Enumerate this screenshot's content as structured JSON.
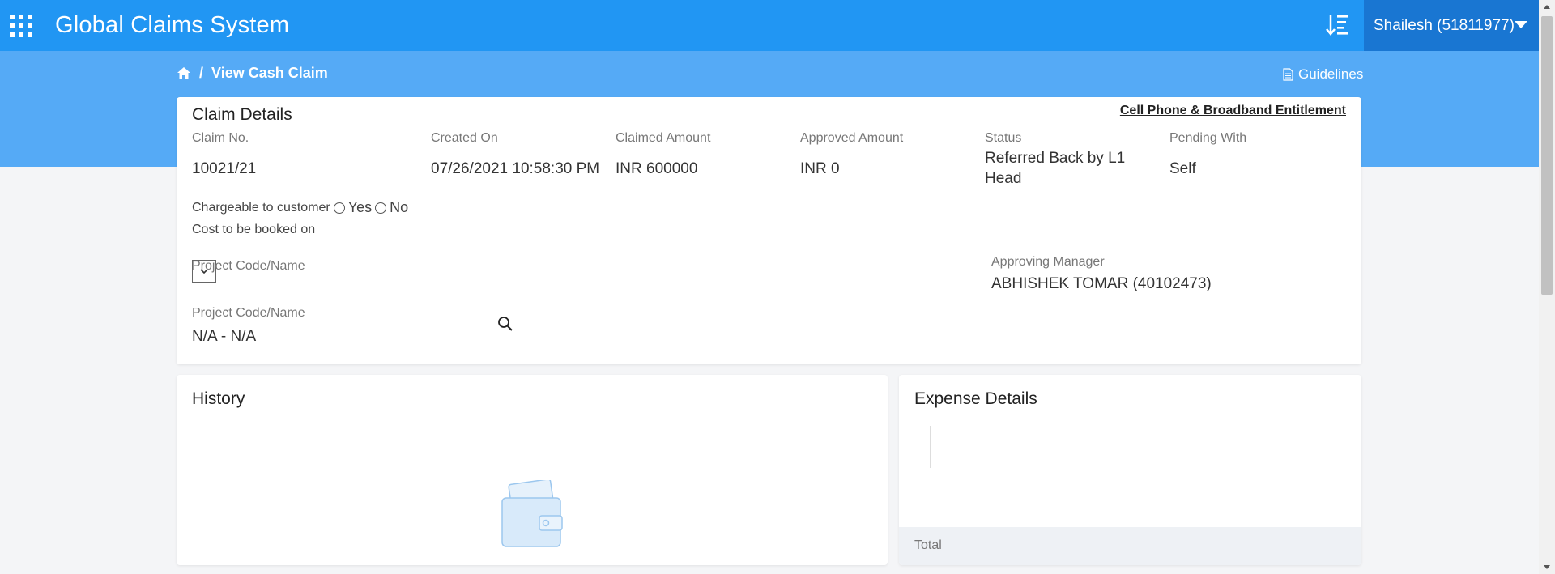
{
  "header": {
    "app_title": "Global Claims System",
    "user_label": "Shailesh (51811977)",
    "apps_icon": "apps-grid-icon",
    "sort_icon": "sort-list-icon"
  },
  "breadcrumb": {
    "home_icon": "home-icon",
    "separator": "/",
    "current": "View Cash Claim"
  },
  "guidelines": {
    "label": "Guidelines",
    "icon": "document-icon"
  },
  "claim_details": {
    "title": "Claim Details",
    "entitlement_link": "Cell Phone & Broadband Entitlement",
    "fields": {
      "claim_no": {
        "label": "Claim No.",
        "value": "10021/21"
      },
      "created_on": {
        "label": "Created On",
        "value": "07/26/2021 10:58:30 PM"
      },
      "claimed_amount": {
        "label": "Claimed Amount",
        "value": "INR 600000"
      },
      "approved_amount": {
        "label": "Approved Amount",
        "value": "INR 0"
      },
      "status": {
        "label": "Status",
        "value": "Referred Back by L1 Head"
      },
      "pending_with": {
        "label": "Pending With",
        "value": "Self"
      }
    },
    "chargeable": {
      "label": "Chargeable to customer",
      "yes": "Yes",
      "no": "No"
    },
    "cost_booked_label": "Cost to be booked on",
    "project_select_label": "Project Code/Name",
    "project": {
      "label": "Project Code/Name",
      "value": "N/A - N/A"
    },
    "approving_manager": {
      "label": "Approving Manager",
      "value": "ABHISHEK TOMAR (40102473)"
    }
  },
  "history": {
    "title": "History",
    "empty_icon": "wallet-icon"
  },
  "expense_details": {
    "title": "Expense Details",
    "total_label": "Total"
  },
  "colors": {
    "topbar": "#2196f3",
    "user_button": "#1976d2",
    "band": "#55aaf6"
  }
}
